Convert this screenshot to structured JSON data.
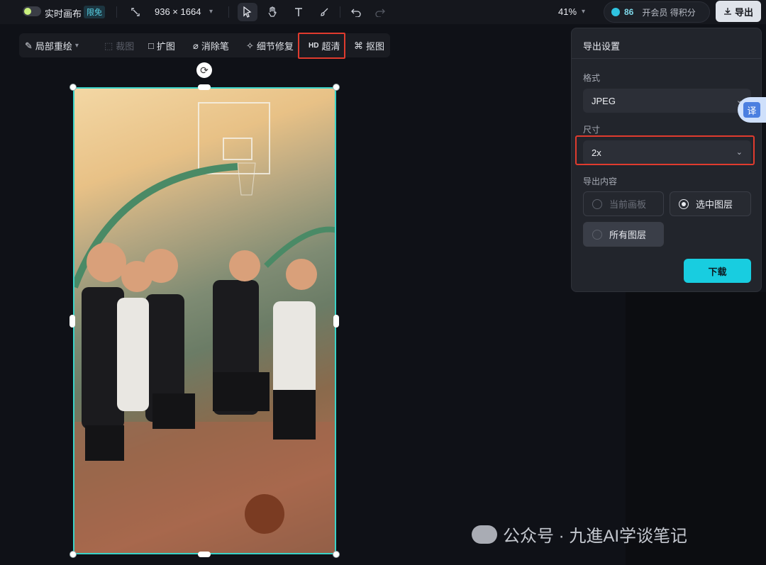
{
  "topbar": {
    "realtime_label": "实时画布",
    "realtime_badge": "限免",
    "canvas_size": "936 × 1664",
    "zoom": "41%",
    "credits_count": "86",
    "credits_text": "开会员 得积分",
    "export_label": "导出"
  },
  "tools": {
    "local_redraw": "局部重绘",
    "crop": "裁图",
    "expand": "扩图",
    "eraser": "消除笔",
    "detail_fix": "细节修复",
    "hd_badge": "HD",
    "super_res": "超清",
    "cutout": "抠图"
  },
  "panel": {
    "title": "导出设置",
    "format_label": "格式",
    "format_value": "JPEG",
    "size_label": "尺寸",
    "size_value": "2x",
    "content_label": "导出内容",
    "options": [
      {
        "label": "当前画板",
        "state": "disabled"
      },
      {
        "label": "选中图层",
        "state": "selected"
      },
      {
        "label": "所有图层",
        "state": "unselected"
      }
    ],
    "download_label": "下载"
  },
  "translate_label": "译",
  "watermark": "公众号 · 九進AI学谈笔记",
  "colors": {
    "accent": "#18cde0",
    "highlight_box": "#e03b2e",
    "selection_border": "#3ad3c8"
  }
}
